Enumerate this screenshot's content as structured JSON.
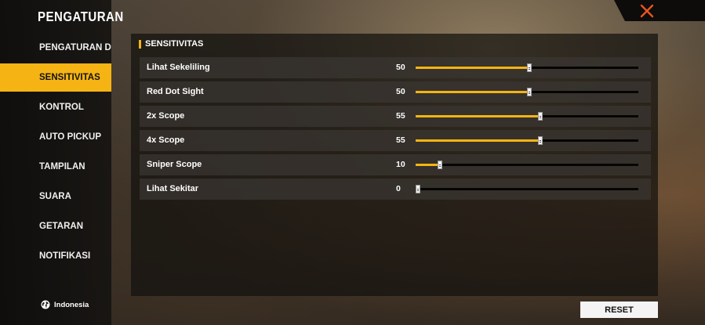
{
  "sidebar": {
    "title": "PENGATURAN",
    "items": [
      {
        "label": "PENGATURAN DASAR",
        "active": false
      },
      {
        "label": "SENSITIVITAS",
        "active": true
      },
      {
        "label": "KONTROL",
        "active": false
      },
      {
        "label": "AUTO PICKUP",
        "active": false
      },
      {
        "label": "TAMPILAN",
        "active": false
      },
      {
        "label": "SUARA",
        "active": false
      },
      {
        "label": "GETARAN",
        "active": false
      },
      {
        "label": "NOTIFIKASI",
        "active": false
      }
    ],
    "language": {
      "icon": "globe-icon",
      "label": "Indonesia"
    }
  },
  "close": {
    "icon": "close-icon"
  },
  "section": {
    "title": "SENSITIVITAS"
  },
  "sliders": [
    {
      "label": "Lihat Sekeliling",
      "value": 50,
      "max": 100
    },
    {
      "label": "Red Dot Sight",
      "value": 50,
      "max": 100
    },
    {
      "label": "2x Scope",
      "value": 55,
      "max": 100
    },
    {
      "label": "4x Scope",
      "value": 55,
      "max": 100
    },
    {
      "label": "Sniper Scope",
      "value": 10,
      "max": 100
    },
    {
      "label": "Lihat Sekitar",
      "value": 0,
      "max": 100
    }
  ],
  "reset": {
    "label": "RESET"
  },
  "colors": {
    "accent": "#f5b414",
    "track": "#050505"
  }
}
